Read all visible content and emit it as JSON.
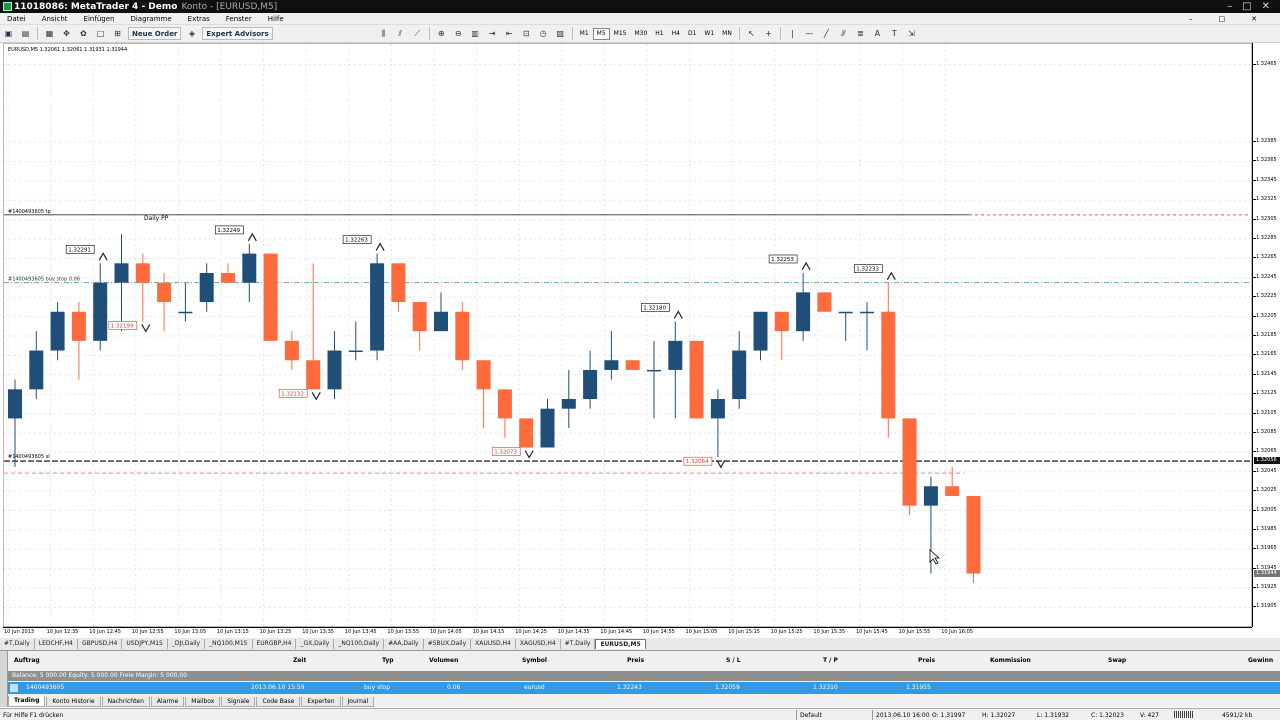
{
  "titlebar": {
    "title": "11018086: MetaTrader 4 - Demo",
    "subtitle": "Konto - [EURUSD,M5]",
    "min": "–",
    "max": "□",
    "close": "✕"
  },
  "menu": [
    "Datei",
    "Ansicht",
    "Einfügen",
    "Diagramme",
    "Extras",
    "Fenster",
    "Hilfe"
  ],
  "menu_controls": [
    "–",
    "□",
    "✕"
  ],
  "toolbar": {
    "new_order": "Neue Order",
    "expert_advisors": "Expert Advisors",
    "timeframes": [
      "M1",
      "M5",
      "M15",
      "M30",
      "H1",
      "H4",
      "D1",
      "W1",
      "MN"
    ],
    "active_tf": "M5"
  },
  "chart": {
    "info": "EURUSD,M5  1.32061 1.32061 1.31931 1.31944",
    "daily_pp": "Daily PP",
    "tp_label": "#1400493605 tp",
    "order_label": "#1400493605 buy stop 0.06",
    "sl_label": "#1400493605 sl",
    "current_price": "1.31944",
    "sl_price": "1.32056"
  },
  "chart_data": {
    "type": "candlestick",
    "symbol": "EURUSD",
    "timeframe": "M5",
    "ylim": [
      1.3189,
      1.3248
    ],
    "price_ticks": [
      "1.32465",
      "1.32385",
      "1.32365",
      "1.32345",
      "1.32325",
      "1.32305",
      "1.32285",
      "1.32265",
      "1.32245",
      "1.32225",
      "1.32205",
      "1.32185",
      "1.32165",
      "1.32145",
      "1.32125",
      "1.32105",
      "1.32085",
      "1.32065",
      "1.32045",
      "1.32025",
      "1.32005",
      "1.31985",
      "1.31965",
      "1.31945",
      "1.31925",
      "1.31905",
      "1.31885"
    ],
    "time_labels": [
      "10 Jun 2013",
      "10 Jun 12:35",
      "10 Jun 12:45",
      "10 Jun 12:55",
      "10 Jun 13:05",
      "10 Jun 13:15",
      "10 Jun 13:25",
      "10 Jun 13:35",
      "10 Jun 13:45",
      "10 Jun 13:55",
      "10 Jun 14:05",
      "10 Jun 14:15",
      "10 Jun 14:25",
      "10 Jun 14:35",
      "10 Jun 14:45",
      "10 Jun 14:55",
      "10 Jun 15:05",
      "10 Jun 15:15",
      "10 Jun 15:25",
      "10 Jun 15:35",
      "10 Jun 15:45",
      "10 Jun 15:55",
      "10 Jun 16:05"
    ],
    "candles": [
      {
        "o": 1.321,
        "h": 1.3214,
        "l": 1.3205,
        "c": 1.3213
      },
      {
        "o": 1.3213,
        "h": 1.3219,
        "l": 1.3212,
        "c": 1.3217
      },
      {
        "o": 1.3217,
        "h": 1.3222,
        "l": 1.3216,
        "c": 1.3221
      },
      {
        "o": 1.3221,
        "h": 1.3222,
        "l": 1.3214,
        "c": 1.3218
      },
      {
        "o": 1.3218,
        "h": 1.3226,
        "l": 1.3217,
        "c": 1.3224
      },
      {
        "o": 1.3224,
        "h": 1.3229,
        "l": 1.3219,
        "c": 1.3226
      },
      {
        "o": 1.3226,
        "h": 1.3227,
        "l": 1.322,
        "c": 1.3224
      },
      {
        "o": 1.3224,
        "h": 1.3225,
        "l": 1.3219,
        "c": 1.3222
      },
      {
        "o": 1.3221,
        "h": 1.3224,
        "l": 1.322,
        "c": 1.3221
      },
      {
        "o": 1.3222,
        "h": 1.3226,
        "l": 1.3221,
        "c": 1.3225
      },
      {
        "o": 1.3225,
        "h": 1.3226,
        "l": 1.3224,
        "c": 1.3224
      },
      {
        "o": 1.3224,
        "h": 1.3228,
        "l": 1.3222,
        "c": 1.3227
      },
      {
        "o": 1.3227,
        "h": 1.3227,
        "l": 1.3218,
        "c": 1.3218
      },
      {
        "o": 1.3218,
        "h": 1.3219,
        "l": 1.3215,
        "c": 1.3216
      },
      {
        "o": 1.3216,
        "h": 1.3226,
        "l": 1.3213,
        "c": 1.3213
      },
      {
        "o": 1.3213,
        "h": 1.3219,
        "l": 1.3212,
        "c": 1.3217
      },
      {
        "o": 1.3217,
        "h": 1.322,
        "l": 1.3216,
        "c": 1.3217
      },
      {
        "o": 1.3217,
        "h": 1.3227,
        "l": 1.3216,
        "c": 1.3226
      },
      {
        "o": 1.3226,
        "h": 1.3226,
        "l": 1.3221,
        "c": 1.3222
      },
      {
        "o": 1.3222,
        "h": 1.3222,
        "l": 1.3217,
        "c": 1.3219
      },
      {
        "o": 1.3219,
        "h": 1.3223,
        "l": 1.3219,
        "c": 1.3221
      },
      {
        "o": 1.3221,
        "h": 1.3222,
        "l": 1.3215,
        "c": 1.3216
      },
      {
        "o": 1.3216,
        "h": 1.3216,
        "l": 1.3209,
        "c": 1.3213
      },
      {
        "o": 1.3213,
        "h": 1.3213,
        "l": 1.3208,
        "c": 1.321
      },
      {
        "o": 1.321,
        "h": 1.321,
        "l": 1.3207,
        "c": 1.3207
      },
      {
        "o": 1.3207,
        "h": 1.3212,
        "l": 1.3207,
        "c": 1.3211
      },
      {
        "o": 1.3211,
        "h": 1.3215,
        "l": 1.3209,
        "c": 1.3212
      },
      {
        "o": 1.3212,
        "h": 1.3217,
        "l": 1.3211,
        "c": 1.3215
      },
      {
        "o": 1.3215,
        "h": 1.3219,
        "l": 1.3214,
        "c": 1.3216
      },
      {
        "o": 1.3216,
        "h": 1.3216,
        "l": 1.3215,
        "c": 1.3215
      },
      {
        "o": 1.3215,
        "h": 1.3218,
        "l": 1.321,
        "c": 1.3215
      },
      {
        "o": 1.3215,
        "h": 1.322,
        "l": 1.321,
        "c": 1.3218
      },
      {
        "o": 1.3218,
        "h": 1.3218,
        "l": 1.321,
        "c": 1.321
      },
      {
        "o": 1.321,
        "h": 1.3213,
        "l": 1.3206,
        "c": 1.3212
      },
      {
        "o": 1.3212,
        "h": 1.3219,
        "l": 1.3211,
        "c": 1.3217
      },
      {
        "o": 1.3217,
        "h": 1.3221,
        "l": 1.3216,
        "c": 1.3221
      },
      {
        "o": 1.3221,
        "h": 1.3221,
        "l": 1.3216,
        "c": 1.3219
      },
      {
        "o": 1.3219,
        "h": 1.3225,
        "l": 1.3218,
        "c": 1.3223
      },
      {
        "o": 1.3223,
        "h": 1.3223,
        "l": 1.3221,
        "c": 1.3221
      },
      {
        "o": 1.3221,
        "h": 1.3221,
        "l": 1.3218,
        "c": 1.3221
      },
      {
        "o": 1.3221,
        "h": 1.3222,
        "l": 1.3217,
        "c": 1.3221
      },
      {
        "o": 1.3221,
        "h": 1.3224,
        "l": 1.3208,
        "c": 1.321
      },
      {
        "o": 1.321,
        "h": 1.321,
        "l": 1.32,
        "c": 1.3201
      },
      {
        "o": 1.3201,
        "h": 1.3204,
        "l": 1.3194,
        "c": 1.3203
      },
      {
        "o": 1.3203,
        "h": 1.3205,
        "l": 1.3202,
        "c": 1.3202
      },
      {
        "o": 1.3202,
        "h": 1.3202,
        "l": 1.3193,
        "c": 1.3194
      }
    ],
    "price_labels": [
      {
        "text": "1.32291",
        "i": 4,
        "type": "high"
      },
      {
        "text": "1.32249",
        "i": 11,
        "type": "high"
      },
      {
        "text": "1.32263",
        "i": 17,
        "type": "high"
      },
      {
        "text": "1.32199",
        "i": 6,
        "type": "low"
      },
      {
        "text": "1.32132",
        "i": 14,
        "type": "low"
      },
      {
        "text": "1.32073",
        "i": 24,
        "type": "low"
      },
      {
        "text": "1.32180",
        "i": 31,
        "type": "high"
      },
      {
        "text": "1.32064",
        "i": 33,
        "type": "low"
      },
      {
        "text": "1.32253",
        "i": 37,
        "type": "high"
      },
      {
        "text": "1.32233",
        "i": 41,
        "type": "high"
      }
    ],
    "lines": {
      "tp": 1.3231,
      "order": 1.3224,
      "sl": 1.32056,
      "ask": 1.32056
    },
    "colors": {
      "bull": "#1f4e79",
      "bear": "#ff6b3d",
      "grid": "#e6e6e6"
    }
  },
  "symbol_tabs": [
    "#T,Daily",
    "LEDCHF,H4",
    "GBPUSD,H4",
    "USDJPY,M15",
    "_DJI,Daily",
    "_NQ100,M15",
    "EURGBP,H4",
    "_GX,Daily",
    "_NQ100,Daily",
    "#AA,Daily",
    "#SBUX,Daily",
    "XAUUSD,H4",
    "XAGUSD,H4",
    "#T,Daily",
    "EURUSD,M5"
  ],
  "active_symbol_tab": "EURUSD,M5",
  "terminal": {
    "headers": {
      "order": "Auftrag",
      "time": "Zeit",
      "type": "Typ",
      "volume": "Volumen",
      "symbol": "Symbol",
      "price": "Preis",
      "sl": "S / L",
      "tp": "T / P",
      "price2": "Preis",
      "commission": "Kommission",
      "swap": "Swap",
      "profit": "Gewinn"
    },
    "balance": "Balance: 5 000.00  Equity: 5 000.00  Freie Margin: 5 000.00",
    "row": {
      "order": "1400493605",
      "time": "2013.06.10 15:59",
      "type": "buy stop",
      "volume": "0.06",
      "symbol": "eurusd",
      "price": "1.32243",
      "sl": "1.32059",
      "tp": "1.32310",
      "price2": "1.31955"
    },
    "side_label": "Terminal",
    "tabs": [
      "Trading",
      "Konto Historie",
      "Nachrichten",
      "Alarme",
      "Mailbox",
      "Signale",
      "Code Base",
      "Experten",
      "Journal"
    ],
    "active_tab": "Trading"
  },
  "status": {
    "help": "Für Hilfe F1 drücken",
    "profile": "Default",
    "datetime": "2013.06.10 16:00",
    "open": "O: 1.31997",
    "high": "H: 1.32027",
    "low": "L: 1.31932",
    "close": "C: 1.32023",
    "volume": "V: 427",
    "traffic": "4591/2 kb"
  }
}
